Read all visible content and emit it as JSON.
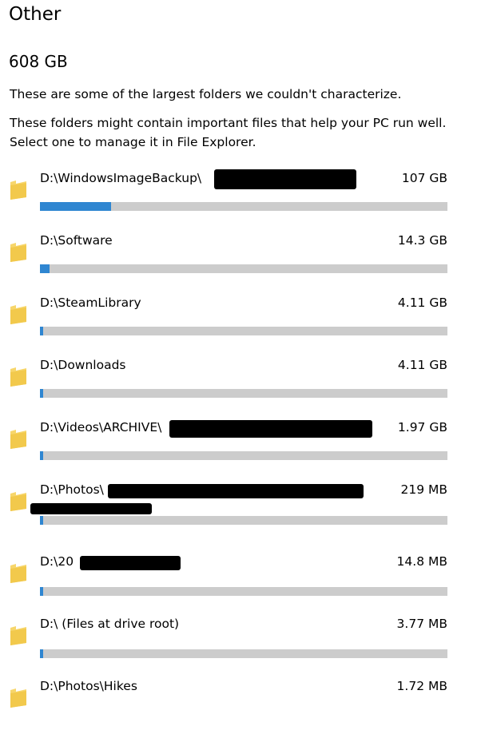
{
  "header": {
    "title": "Other",
    "total_size": "608 GB",
    "description_1": "These are some of the largest folders we couldn't characterize.",
    "description_2": "These folders might contain important files that help your PC run well. Select one to manage it in File Explorer."
  },
  "colors": {
    "bar_fill": "#2f86d1",
    "bar_track": "#cccccc",
    "folder_icon": "#f5cf5a"
  },
  "folders": [
    {
      "path": "D:\\WindowsImageBackup\\",
      "size": "107 GB",
      "usage_fraction": 0.174,
      "redacted": true
    },
    {
      "path": "D:\\Software",
      "size": "14.3 GB",
      "usage_fraction": 0.024,
      "redacted": false
    },
    {
      "path": "D:\\SteamLibrary",
      "size": "4.11 GB",
      "usage_fraction": 0.008,
      "redacted": false
    },
    {
      "path": "D:\\Downloads",
      "size": "4.11 GB",
      "usage_fraction": 0.008,
      "redacted": false
    },
    {
      "path": "D:\\Videos\\ARCHIVE\\",
      "size": "1.97 GB",
      "usage_fraction": 0.008,
      "redacted": true
    },
    {
      "path": "D:\\Photos\\",
      "size": "219 MB",
      "usage_fraction": 0.008,
      "redacted": true
    },
    {
      "path": "D:\\20",
      "size": "14.8 MB",
      "usage_fraction": 0.008,
      "redacted": true
    },
    {
      "path": "D:\\ (Files at drive root)",
      "size": "3.77 MB",
      "usage_fraction": 0.008,
      "redacted": false
    },
    {
      "path": "D:\\Photos\\Hikes",
      "size": "1.72 MB",
      "usage_fraction": 0.008,
      "redacted": false
    }
  ]
}
